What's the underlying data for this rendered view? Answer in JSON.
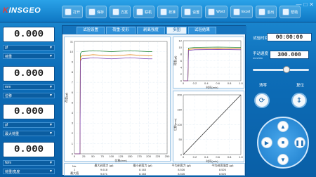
{
  "header": {
    "logo_prefix": "K",
    "logo_text": "INSGEO",
    "toolbar": [
      {
        "label": "打开",
        "icon": "folder-open-icon"
      },
      {
        "label": "保存",
        "icon": "save-icon"
      },
      {
        "label": "方案",
        "icon": "scheme-icon"
      },
      {
        "label": "联机",
        "icon": "connect-icon"
      },
      {
        "label": "校准",
        "icon": "calibrate-icon"
      },
      {
        "label": "设置",
        "icon": "gear-icon"
      },
      {
        "label": "Word",
        "icon": "word-icon"
      },
      {
        "label": "Excel",
        "icon": "excel-icon"
      },
      {
        "label": "退出",
        "icon": "exit-icon"
      },
      {
        "label": "帮助",
        "icon": "help-icon"
      }
    ],
    "window_controls": [
      "—",
      "□",
      "✕"
    ]
  },
  "sensors": [
    {
      "value": "0.000",
      "unit": "gf",
      "mode": "荷重"
    },
    {
      "value": "0.000",
      "unit": "mm",
      "mode": "位移"
    },
    {
      "value": "0.000",
      "unit": "gf",
      "mode": "最大荷重"
    },
    {
      "value": "0.000",
      "unit": "N/m",
      "mode": "荷重/宽度"
    }
  ],
  "tabs": [
    "试验设置",
    "荷重-变形",
    "剥离强度",
    "多图",
    "试验结果"
  ],
  "active_tab": 3,
  "charts": {
    "main": {
      "xlabel": "位移(mm)",
      "ylabel": "荷重(gf)",
      "xticks": [
        "0",
        "25",
        "50",
        "75",
        "100",
        "125",
        "150",
        "175",
        "200",
        "225",
        "250"
      ],
      "yticks": [
        "0",
        "1",
        "2",
        "3",
        "4",
        "5",
        "6",
        "7",
        "8",
        "9",
        "10",
        "11"
      ]
    },
    "small_top": {
      "xlabel": "时间(min)",
      "ylabel": "荷重(gf)",
      "xticks": [
        "0",
        "0.2",
        "0.4",
        "0.6",
        "0.8",
        "1.0"
      ],
      "yticks": [
        "0",
        "2",
        "4",
        "6",
        "8",
        "10",
        "12"
      ]
    },
    "small_bottom": {
      "xlabel": "时间(min)",
      "ylabel": "位移(mm)",
      "xticks": [
        "0",
        "0.2",
        "0.4",
        "0.6",
        "0.8",
        "1.0"
      ],
      "yticks": [
        "0",
        "50",
        "100",
        "150",
        "200"
      ]
    }
  },
  "chart_data": [
    {
      "type": "line",
      "title": "",
      "xlabel": "位移(mm)",
      "ylabel": "荷重(gf)",
      "xlim": [
        0,
        250
      ],
      "ylim": [
        0,
        11
      ],
      "grid": true,
      "series": [
        {
          "color": "#2b8a3e",
          "x": [
            0,
            15,
            16,
            20,
            50,
            100,
            150,
            200,
            210
          ],
          "y": [
            0,
            0,
            9.8,
            10.0,
            10.1,
            10.0,
            10.1,
            10.0,
            10.0
          ]
        },
        {
          "color": "#e07b00",
          "x": [
            0,
            15,
            16,
            20,
            50,
            100,
            150,
            200,
            210
          ],
          "y": [
            0,
            0,
            9.4,
            9.6,
            9.7,
            9.6,
            9.7,
            9.6,
            9.6
          ]
        },
        {
          "color": "#7b3fb0",
          "x": [
            0,
            15,
            16,
            20,
            50,
            100,
            150,
            200,
            210
          ],
          "y": [
            0,
            0,
            9.1,
            9.3,
            9.4,
            9.3,
            9.4,
            9.3,
            9.3
          ]
        }
      ]
    },
    {
      "type": "line",
      "title": "",
      "xlabel": "时间(min)",
      "ylabel": "荷重(gf)",
      "xlim": [
        0,
        1.0
      ],
      "ylim": [
        0,
        12
      ],
      "grid": true,
      "series": [
        {
          "color": "#2b8a3e",
          "x": [
            0,
            0.08,
            0.09,
            0.2,
            0.6,
            1.0
          ],
          "y": [
            0,
            0,
            9.8,
            10.0,
            10.1,
            10.0
          ]
        },
        {
          "color": "#e07b00",
          "x": [
            0,
            0.08,
            0.09,
            0.2,
            0.6,
            1.0
          ],
          "y": [
            0,
            0,
            9.4,
            9.6,
            9.7,
            9.6
          ]
        },
        {
          "color": "#7b3fb0",
          "x": [
            0,
            0.08,
            0.09,
            0.2,
            0.6,
            1.0
          ],
          "y": [
            0,
            0,
            9.1,
            9.3,
            9.4,
            9.3
          ]
        }
      ]
    },
    {
      "type": "line",
      "title": "",
      "xlabel": "时间(min)",
      "ylabel": "位移(mm)",
      "xlim": [
        0,
        1.0
      ],
      "ylim": [
        0,
        200
      ],
      "grid": true,
      "series": [
        {
          "color": "#333333",
          "x": [
            0,
            1.0
          ],
          "y": [
            0,
            200
          ]
        }
      ]
    }
  ],
  "results": {
    "headers": [
      "No.",
      "最大剥离力\n(gf)",
      "最小剥离力\n(gf)",
      "平均剥离力\n(gf)",
      "平均剥离强度\n(gf)"
    ],
    "rows": [
      [
        "1",
        "9.618",
        "8.163",
        "8.526",
        "8.526"
      ],
      [
        "最大值",
        "9.671",
        "8.163",
        "8.526",
        "8.526"
      ],
      [
        "最小值",
        "9.554",
        "8.163",
        "8.526",
        "8.526"
      ]
    ]
  },
  "right": {
    "time_label": "试验时间",
    "time_value": "00:00:00",
    "speed_label": "手动速度",
    "speed_unit": "mm/min",
    "speed_value": "300.000",
    "slider_fraction": 0.6,
    "zero_label": "清零",
    "reset_label": "复位"
  }
}
